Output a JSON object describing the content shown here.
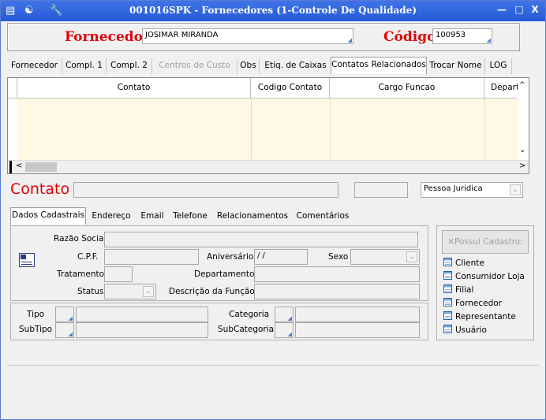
{
  "window": {
    "title": "001016SPK - Fornecedores (1-Controle De Qualidade)",
    "minimize_glyph": "—",
    "maximize_glyph": "□",
    "close_glyph": "X"
  },
  "header": {
    "fornecedor_label": "Fornecedor",
    "fornecedor_value": "JOSIMAR MIRANDA",
    "codigo_label": "Código",
    "codigo_value": "100953"
  },
  "tabs": [
    {
      "label": "Fornecedor"
    },
    {
      "label": "Compl. 1"
    },
    {
      "label": "Compl. 2"
    },
    {
      "label": "Centros de Custo"
    },
    {
      "label": "Obs"
    },
    {
      "label": "Etiq. de Caixas"
    },
    {
      "label": "Contatos Relacionados"
    },
    {
      "label": "Trocar Nome"
    },
    {
      "label": "LOG"
    }
  ],
  "grid": {
    "columns": [
      "Contato",
      "Codigo Contato",
      "Cargo Funcao",
      "Departam"
    ]
  },
  "contato": {
    "label": "Contato",
    "name_value": "",
    "code_value": "",
    "type_value": "Pessoa Juridica"
  },
  "inner_tabs": [
    {
      "label": "Dados Cadastrais"
    },
    {
      "label": "Endereço"
    },
    {
      "label": "Email"
    },
    {
      "label": "Telefone"
    },
    {
      "label": "Relacionamentos"
    },
    {
      "label": "Comentários"
    }
  ],
  "form": {
    "razao_social_label": "Razão Social",
    "cpf_label": "C.P.F.",
    "aniversario_label": "Aniversário",
    "aniversario_value": "/ /",
    "sexo_label": "Sexo",
    "tratamento_label": "Tratamento",
    "departamento_label": "Departamento",
    "status_label": "Status",
    "descricao_funcao_label": "Descrição da Função",
    "tipo_label": "Tipo",
    "categoria_label": "Categoria",
    "subtipo_label": "SubTipo",
    "subcategoria_label": "SubCategoria"
  },
  "possui": {
    "button_label": "Possui Cadastro:",
    "items": [
      "Cliente",
      "Consumidor Loja",
      "Filial",
      "Fornecedor",
      "Representante",
      "Usuário"
    ]
  }
}
